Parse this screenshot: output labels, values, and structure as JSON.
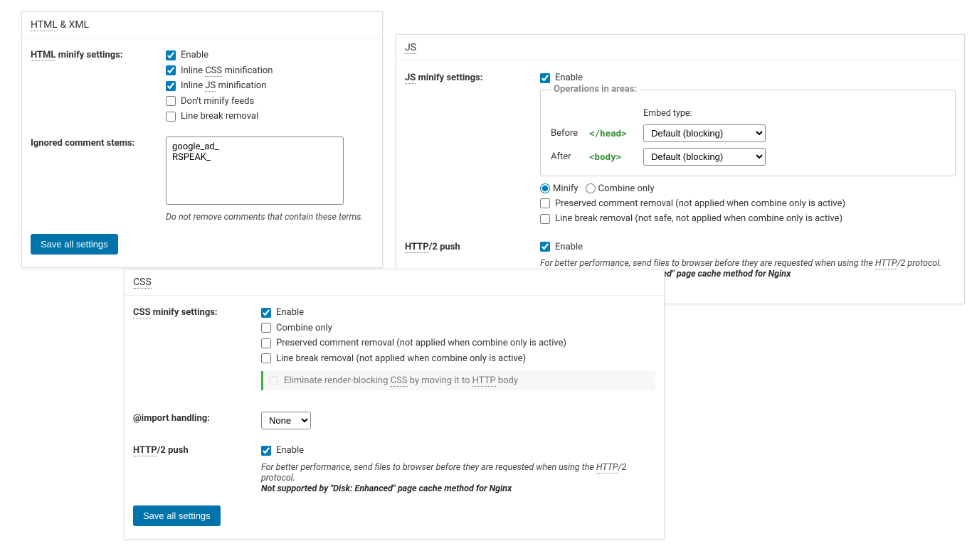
{
  "html_panel": {
    "title_abbr": "HTML",
    "title_rest": " & XML",
    "label_abbr": "HTML",
    "label_rest": " minify settings:",
    "enable": "Enable",
    "inline_css_pre": "Inline ",
    "inline_css_abbr": "CSS",
    "inline_css_post": " minification",
    "inline_js_pre": "Inline ",
    "inline_js_abbr": "JS",
    "inline_js_post": " minification",
    "dont_minify_feeds": "Don't minify feeds",
    "line_break_removal": "Line break removal",
    "ignored_label": "Ignored comment stems:",
    "ignored_value": "google_ad_\nRSPEAK_",
    "ignored_helper": "Do not remove comments that contain these terms.",
    "save_btn": "Save all settings"
  },
  "css_panel": {
    "title_abbr": "CSS",
    "label_abbr": "CSS",
    "label_rest": " minify settings:",
    "enable": "Enable",
    "combine_only": "Combine only",
    "preserved": "Preserved comment removal (not applied when combine only is active)",
    "line_break": "Line break removal (not applied when combine only is active)",
    "elim_pre": "Eliminate render-blocking ",
    "elim_css": "CSS",
    "elim_mid": " by moving it to ",
    "elim_http": "HTTP",
    "elim_post": " body",
    "import_label": "@import handling:",
    "import_value": "None",
    "http2_abbr": "HTTP",
    "http2_rest": "/2 push",
    "http2_enable": "Enable",
    "http2_help_pre": "For better performance, send files to browser before they are requested when using the ",
    "http2_help_abbr": "HTTP",
    "http2_help_post": "/2 protocol.",
    "http2_warn": "Not supported by \"Disk: Enhanced\" page cache method for Nginx",
    "save_btn": "Save all settings"
  },
  "js_panel": {
    "title_abbr": "JS",
    "label_abbr": "JS",
    "label_rest": " minify settings:",
    "enable": "Enable",
    "ops_legend": "Operations in areas:",
    "embed_type": "Embed type:",
    "before": "Before",
    "after": "After",
    "head_tag": "</head>",
    "body_tag": "<body>",
    "embed_value": "Default (blocking)",
    "minify": "Minify",
    "combine_only": "Combine only",
    "preserved": "Preserved comment removal (not applied when combine only is active)",
    "line_break": "Line break removal (not safe, not applied when combine only is active)",
    "http2_abbr": "HTTP",
    "http2_rest": "/2 push",
    "http2_enable": "Enable",
    "http2_help_pre": "For better performance, send files to browser before they are requested when using the ",
    "http2_help_abbr": "HTTP",
    "http2_help_post": "/2 protocol.",
    "http2_warn": "Not supported by \"Disk: Enhanced\" page cache method for Nginx"
  }
}
